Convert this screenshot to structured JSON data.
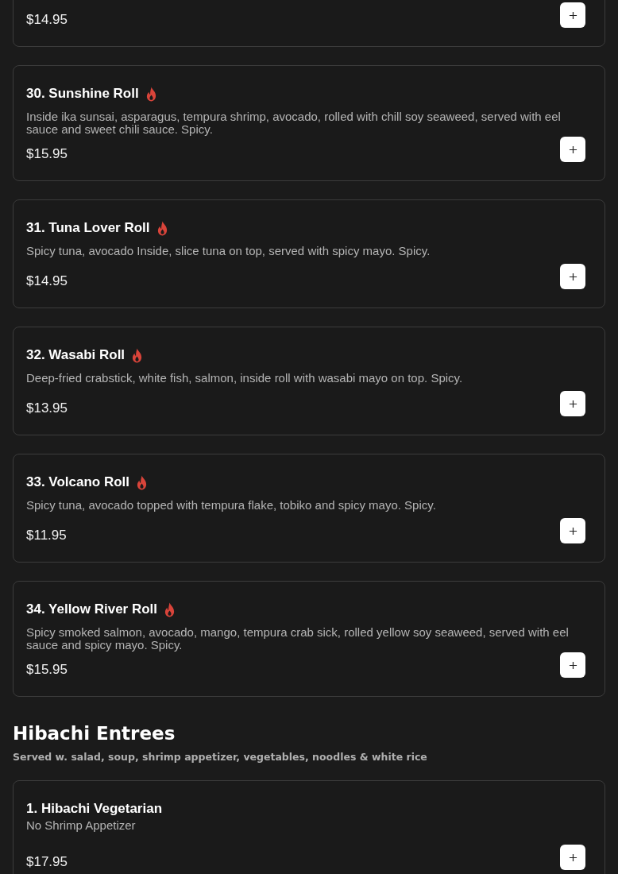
{
  "sections": [
    {
      "items": [
        {
          "price": "$14.95"
        },
        {
          "name": "30. Sunshine Roll",
          "spicy": true,
          "description": "Inside ika sunsai, asparagus, tempura shrimp, avocado, rolled with chill soy seaweed, served with eel sauce and sweet chili sauce. Spicy.",
          "price": "$15.95"
        },
        {
          "name": "31. Tuna Lover Roll",
          "spicy": true,
          "description": "Spicy tuna, avocado Inside, slice tuna on top, served with spicy mayo. Spicy.",
          "price": "$14.95"
        },
        {
          "name": "32. Wasabi Roll",
          "spicy": true,
          "description": "Deep-fried crabstick, white fish, salmon, inside roll with wasabi mayo on top. Spicy.",
          "price": "$13.95"
        },
        {
          "name": "33. Volcano Roll",
          "spicy": true,
          "description": "Spicy tuna, avocado topped with tempura flake, tobiko and spicy mayo. Spicy.",
          "price": "$11.95"
        },
        {
          "name": "34. Yellow River Roll",
          "spicy": true,
          "description": "Spicy smoked salmon, avocado, mango, tempura crab sick, rolled yellow soy seaweed, served with eel sauce and spicy mayo. Spicy.",
          "price": "$15.95"
        }
      ]
    },
    {
      "title": "Hibachi Entrees",
      "subtitle": "Served w. salad, soup, shrimp appetizer, vegetables, noodles & white rice",
      "items": [
        {
          "name": "1. Hibachi Vegetarian",
          "spicy": false,
          "description": "No Shrimp Appetizer",
          "price": "$17.95"
        }
      ]
    }
  ]
}
